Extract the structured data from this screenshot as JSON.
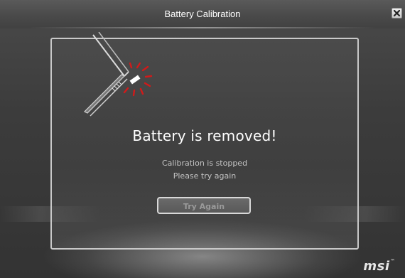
{
  "window": {
    "title": "Battery Calibration",
    "close_icon": "close-icon"
  },
  "dialog": {
    "headline": "Battery is removed!",
    "message_line1": "Calibration is stopped",
    "message_line2": "Please try again",
    "button_label": "Try Again",
    "illustration_icon": "laptop-battery-removed-icon"
  },
  "branding": {
    "logo_text": "msi",
    "trademark": "™"
  },
  "colors": {
    "background": "#3c3c3c",
    "titlebar": "#4a4a4a",
    "panel_border": "#c9c9c9",
    "alert_red": "#d11a1a",
    "headline_text": "#ffffff",
    "message_text": "#c4c4c4"
  }
}
